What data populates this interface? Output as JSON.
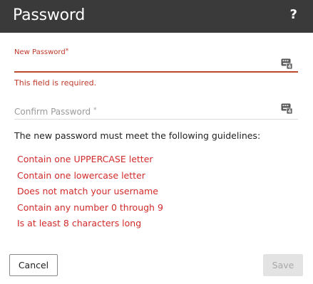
{
  "dialog": {
    "title": "Password",
    "help_icon": "?"
  },
  "new_password": {
    "label": "New Password",
    "required_mark": "*",
    "value": "",
    "error": "This field is required.",
    "icon": "keyboard-icon"
  },
  "confirm_password": {
    "label": "Confirm Password",
    "required_mark": "*",
    "value": "",
    "icon": "keyboard-icon"
  },
  "guidelines": {
    "intro": "The new password must meet the following guidelines:",
    "rules": [
      "Contain one UPPERCASE letter",
      "Contain one lowercase letter",
      "Does not match your username",
      "Contain any number 0 through 9",
      "Is at least 8 characters long"
    ],
    "rule_color": "#d22b2b"
  },
  "buttons": {
    "cancel": "Cancel",
    "save": "Save"
  },
  "colors": {
    "titlebar": "#3a3a3a",
    "error": "#c0392b",
    "disabled_button_bg": "#e3e3e3"
  }
}
